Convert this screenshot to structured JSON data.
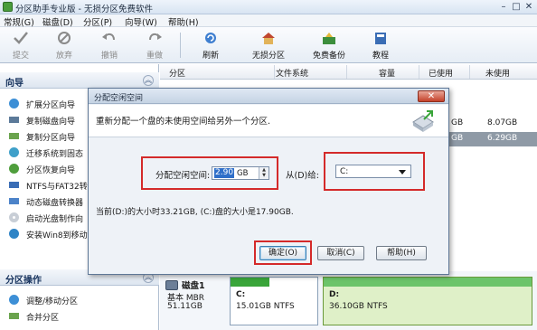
{
  "window": {
    "title": "分区助手专业版 - 无损分区免费软件",
    "minimize": "–",
    "maximize": "□",
    "close": "✕"
  },
  "menu": [
    "常规(G)",
    "磁盘(D)",
    "分区(P)",
    "向导(W)",
    "帮助(H)"
  ],
  "toolbar": {
    "commit": "提交",
    "discard": "放弃",
    "undo": "撤销",
    "redo": "重做",
    "refresh": "刷新",
    "lossless_partition": "无损分区",
    "free_backup": "免费备份",
    "tutorial": "教程"
  },
  "wizard_panel": {
    "title": "向导",
    "items": [
      "扩展分区向导",
      "复制磁盘向导",
      "复制分区向导",
      "迁移系统到固态",
      "分区恢复向导",
      "NTFS与FAT32转换",
      "动态磁盘转换器",
      "启动光盘制作向",
      "安装Win8到移动"
    ]
  },
  "partition_ops_panel": {
    "title": "分区操作",
    "items": [
      "调整/移动分区",
      "合并分区"
    ]
  },
  "partition_list": {
    "columns": [
      "分区",
      "文件系统",
      "容量",
      "已使用",
      "未使用"
    ],
    "rows": [
      {
        "used": "GB",
        "free": "8.07GB"
      },
      {
        "used": "GB",
        "free": "6.29GB"
      }
    ]
  },
  "disk_map": {
    "disk_name": "磁盘1",
    "disk_type": "基本 MBR",
    "disk_size": "51.11GB",
    "partitions": [
      {
        "letter": "C:",
        "info": "15.01GB NTFS",
        "used_fraction": 0.45
      },
      {
        "letter": "D:",
        "info": "36.10GB NTFS",
        "used_fraction": 1.0
      }
    ]
  },
  "dialog": {
    "title": "分配空闲空间",
    "close": "✕",
    "description": "重新分配一个盘的未使用空间给另外一个分区.",
    "size_label": "分配空闲空间:",
    "size_value": "2.90",
    "size_unit": "GB",
    "from_label": "从(D)给:",
    "target_value": "C:",
    "info": "当前(D:)的大小时33.21GB, (C:)盘的大小是17.90GB.",
    "ok": "确定(O)",
    "cancel": "取消(C)",
    "help": "帮助(H)"
  },
  "colors": {
    "highlight": "#d42a2a",
    "selected_row": "#8f9aa6",
    "c_used_bar": "#3aa53a",
    "d_used_bar": "#6cc46a",
    "d_block_bg": "#dff0c8"
  }
}
